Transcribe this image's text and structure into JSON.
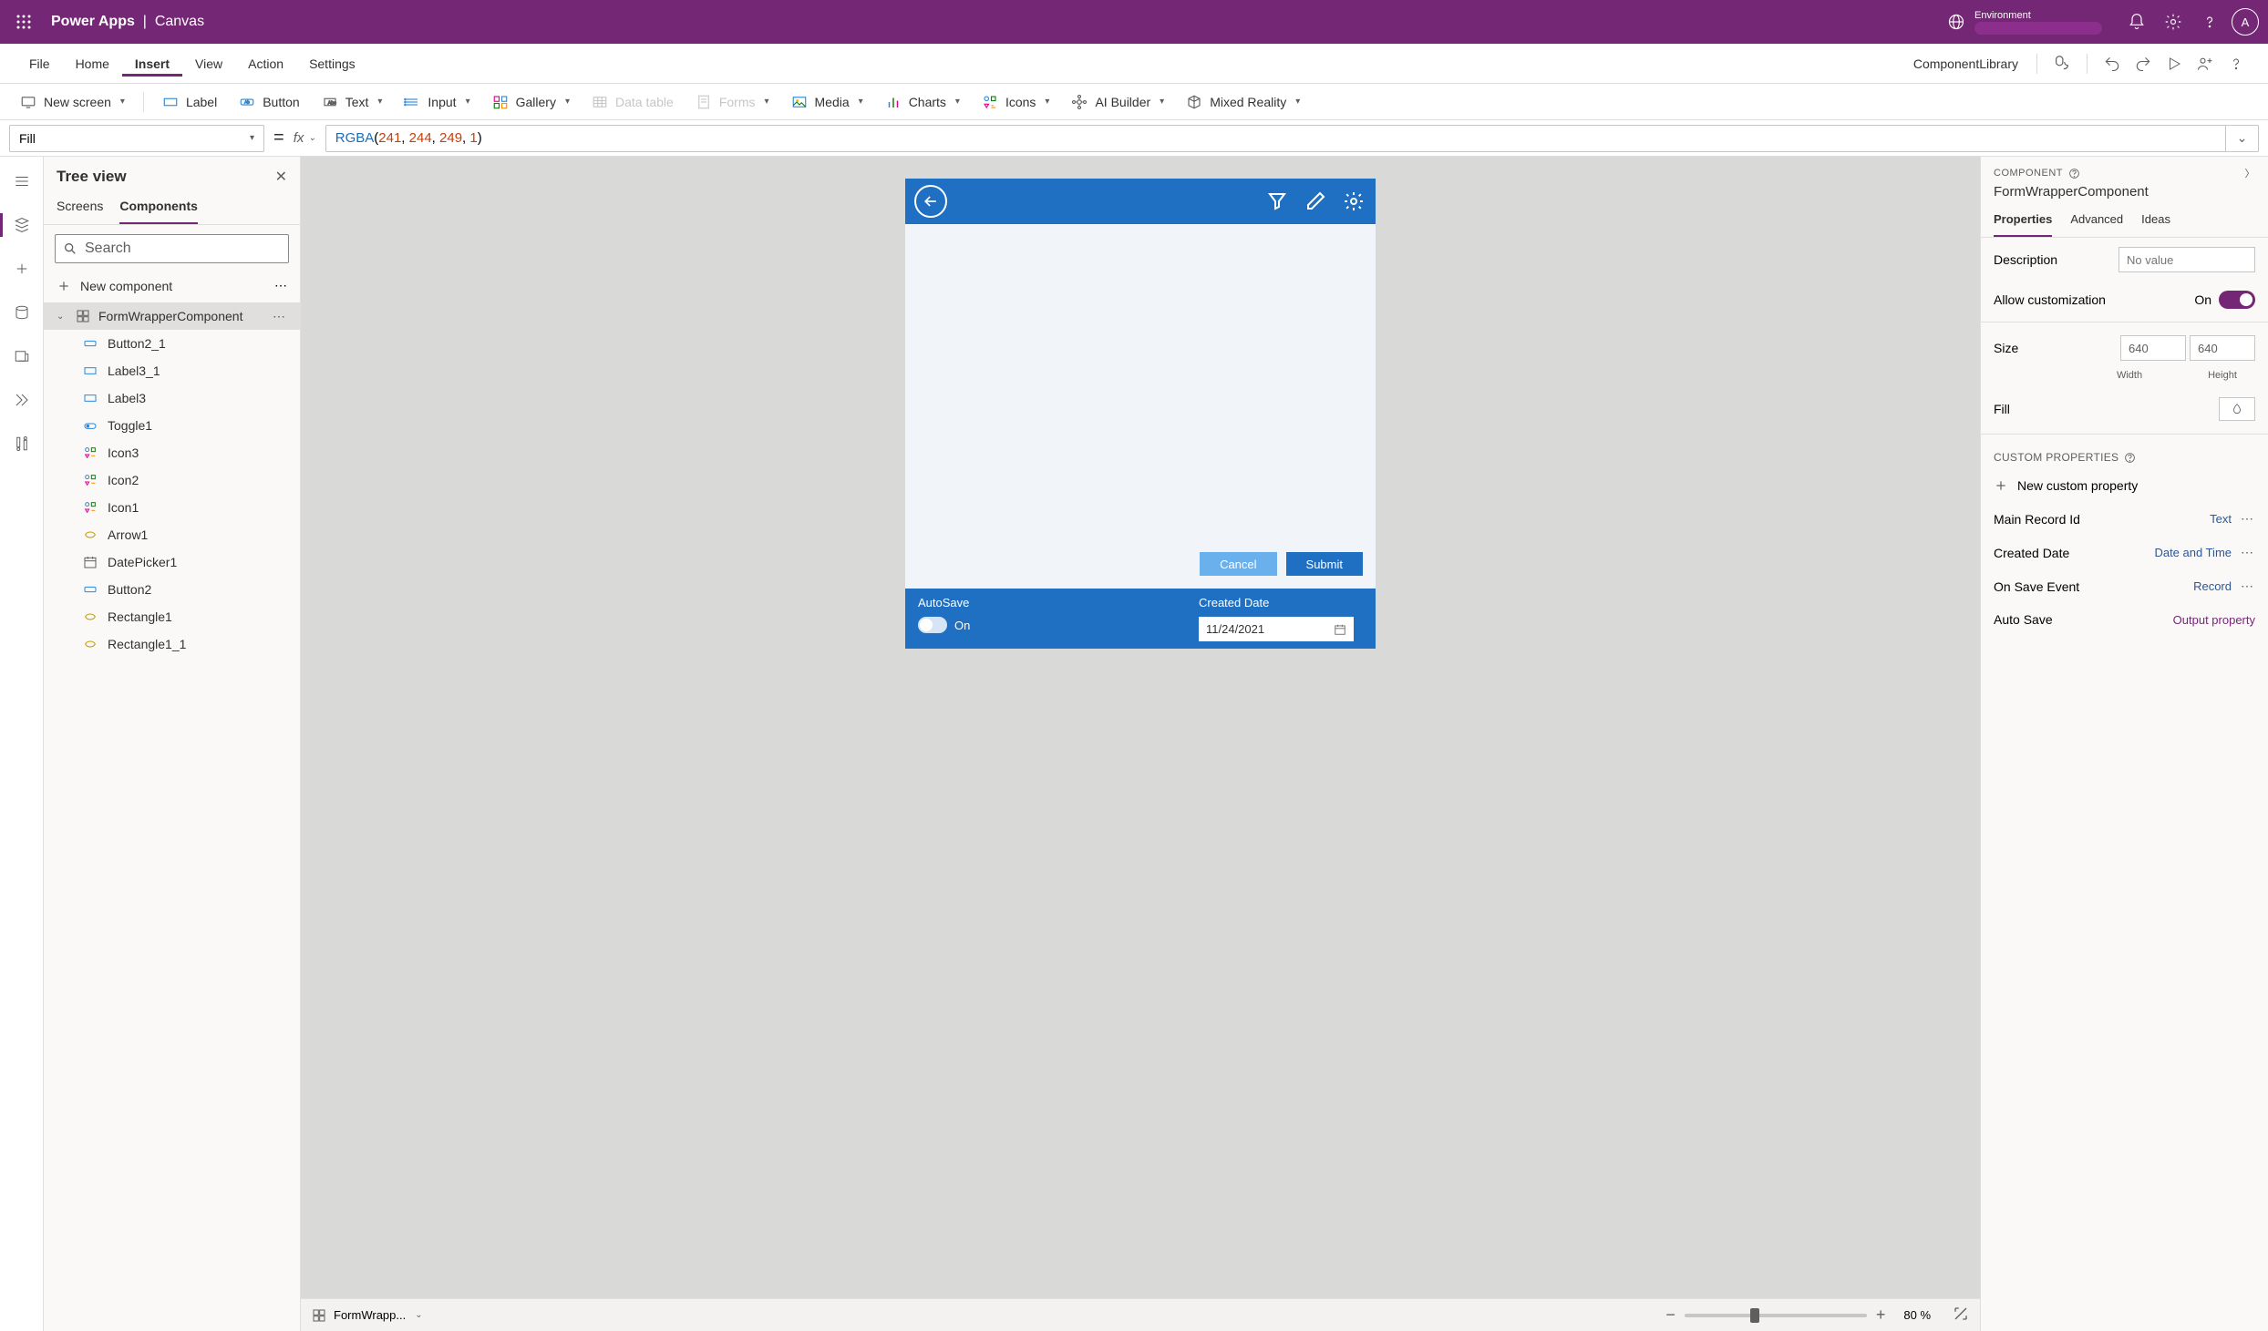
{
  "header": {
    "app_name": "Power Apps",
    "context": "Canvas",
    "env_label": "Environment",
    "avatar_letter": "A"
  },
  "menu": {
    "items": [
      "File",
      "Home",
      "Insert",
      "View",
      "Action",
      "Settings"
    ],
    "active_index": 2,
    "component_library": "ComponentLibrary"
  },
  "ribbon": {
    "new_screen": "New screen",
    "label": "Label",
    "button": "Button",
    "text": "Text",
    "input": "Input",
    "gallery": "Gallery",
    "data_table": "Data table",
    "forms": "Forms",
    "media": "Media",
    "charts": "Charts",
    "icons": "Icons",
    "ai_builder": "AI Builder",
    "mixed_reality": "Mixed Reality"
  },
  "formula": {
    "property": "Fill",
    "fx": "fx",
    "expr_func": "RGBA",
    "expr_args": [
      "241",
      "244",
      "249",
      "1"
    ]
  },
  "tree": {
    "title": "Tree view",
    "tabs": [
      "Screens",
      "Components"
    ],
    "active_tab": 1,
    "search_placeholder": "Search",
    "new_component": "New component",
    "root": "FormWrapperComponent",
    "children": [
      {
        "icon": "button",
        "label": "Button2_1"
      },
      {
        "icon": "label",
        "label": "Label3_1"
      },
      {
        "icon": "label",
        "label": "Label3"
      },
      {
        "icon": "toggle",
        "label": "Toggle1"
      },
      {
        "icon": "icons",
        "label": "Icon3"
      },
      {
        "icon": "icons",
        "label": "Icon2"
      },
      {
        "icon": "icons",
        "label": "Icon1"
      },
      {
        "icon": "shape",
        "label": "Arrow1"
      },
      {
        "icon": "date",
        "label": "DatePicker1"
      },
      {
        "icon": "button",
        "label": "Button2"
      },
      {
        "icon": "shape",
        "label": "Rectangle1"
      },
      {
        "icon": "shape",
        "label": "Rectangle1_1"
      }
    ]
  },
  "canvas": {
    "autosave_label": "AutoSave",
    "autosave_value_label": "On",
    "created_label": "Created Date",
    "created_value": "11/24/2021",
    "cancel": "Cancel",
    "submit": "Submit",
    "selected_element": "FormWrapp...",
    "zoom_value": "80",
    "zoom_unit": "%"
  },
  "props": {
    "header": "COMPONENT",
    "title": "FormWrapperComponent",
    "tabs": [
      "Properties",
      "Advanced",
      "Ideas"
    ],
    "active_tab": 0,
    "description_label": "Description",
    "description_value": "No value",
    "allow_custom_label": "Allow customization",
    "allow_custom_value": "On",
    "size_label": "Size",
    "size_width": "640",
    "size_height": "640",
    "width_label": "Width",
    "height_label": "Height",
    "fill_label": "Fill",
    "custom_header": "CUSTOM PROPERTIES",
    "new_custom": "New custom property",
    "custom_props": [
      {
        "name": "Main Record Id",
        "type": "Text"
      },
      {
        "name": "Created Date",
        "type": "Date and Time"
      },
      {
        "name": "On Save Event",
        "type": "Record"
      },
      {
        "name": "Auto Save",
        "type": "Output property",
        "purple": true
      }
    ]
  }
}
